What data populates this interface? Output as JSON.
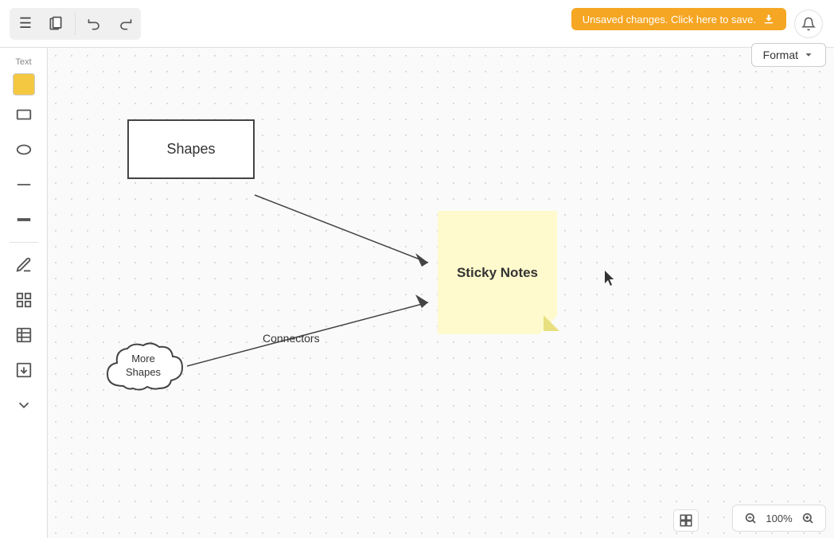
{
  "toolbar": {
    "menu_icon": "☰",
    "page_icon": "□",
    "undo_icon": "↩",
    "redo_icon": "↪"
  },
  "banner": {
    "text": "Unsaved changes. Click here to save.",
    "icon": "⬇"
  },
  "bell": {
    "icon": "🔔"
  },
  "format_btn": {
    "label": "Format",
    "icon": "▾"
  },
  "sidebar": {
    "text_label": "Text",
    "swatch_color": "#f5c842",
    "items": [
      {
        "name": "rectangle-tool",
        "icon": "rect"
      },
      {
        "name": "ellipse-tool",
        "icon": "ellipse"
      },
      {
        "name": "line-tool",
        "icon": "line"
      },
      {
        "name": "thick-line-tool",
        "icon": "thick-line"
      },
      {
        "name": "draw-tool",
        "icon": "draw"
      },
      {
        "name": "shapes-library-tool",
        "icon": "shapes"
      },
      {
        "name": "table-tool",
        "icon": "table"
      },
      {
        "name": "import-tool",
        "icon": "import"
      },
      {
        "name": "more-tools",
        "icon": "chevron-down"
      }
    ]
  },
  "canvas": {
    "shapes_box_label": "Shapes",
    "sticky_note_label": "Sticky Notes",
    "more_shapes_label": "More\nShapes",
    "connectors_label": "Connectors"
  },
  "zoom": {
    "level": "100%",
    "zoom_in_icon": "🔍+",
    "zoom_out_icon": "🔍-",
    "map_icon": "⊞"
  }
}
